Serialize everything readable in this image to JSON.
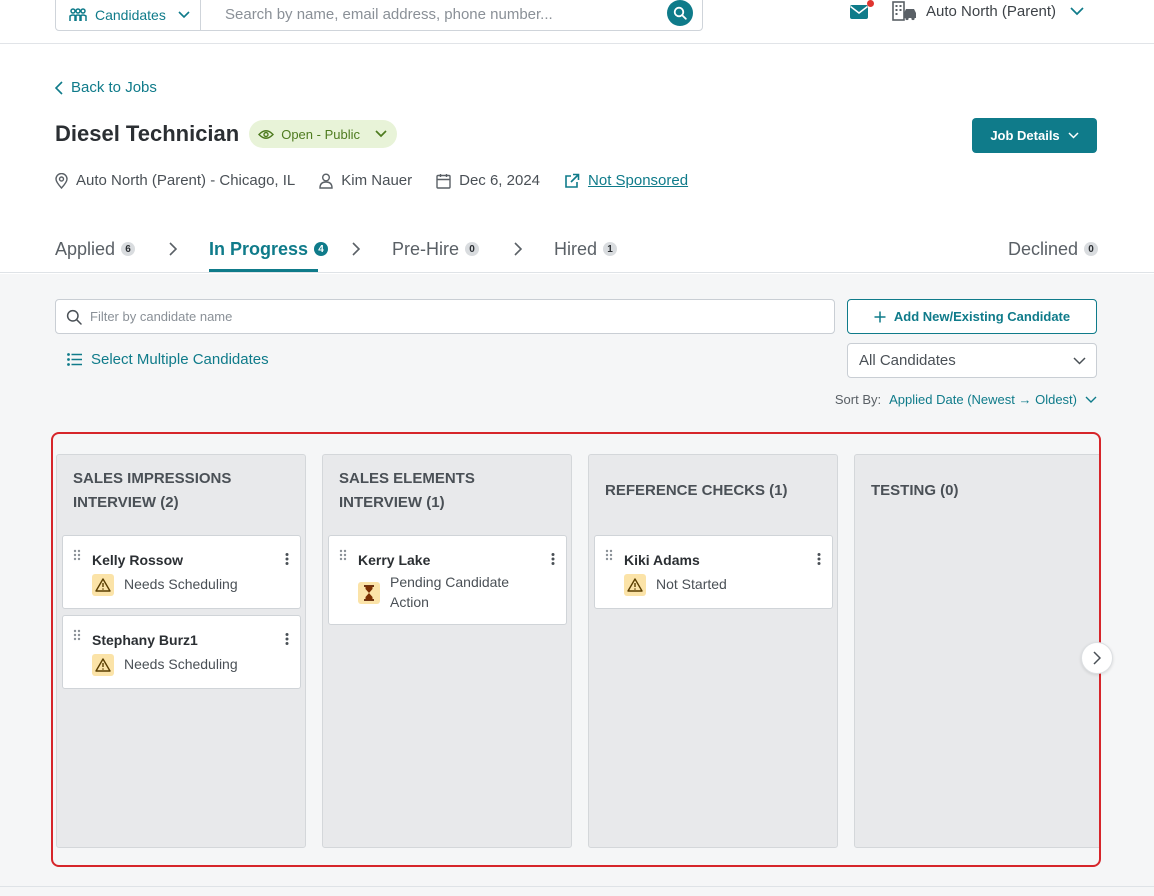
{
  "topbar": {
    "entity_select": "Candidates",
    "search_placeholder": "Search by name, email address, phone number...",
    "org_name": "Auto North (Parent)"
  },
  "header": {
    "back_label": "Back to Jobs",
    "job_title": "Diesel Technician",
    "status": "Open - Public",
    "job_details_label": "Job Details",
    "location": "Auto North (Parent) - Chicago, IL",
    "recruiter": "Kim Nauer",
    "date": "Dec 6, 2024",
    "sponsorship": "Not Sponsored"
  },
  "tabs": [
    {
      "label": "Applied",
      "count": "6"
    },
    {
      "label": "In Progress",
      "count": "4"
    },
    {
      "label": "Pre-Hire",
      "count": "0"
    },
    {
      "label": "Hired",
      "count": "1"
    },
    {
      "label": "Declined",
      "count": "0"
    }
  ],
  "toolbar": {
    "filter_placeholder": "Filter by candidate name",
    "add_candidate_label": "Add New/Existing Candidate",
    "select_multiple_label": "Select Multiple Candidates",
    "candidate_filter_value": "All Candidates",
    "sort_label": "Sort By:",
    "sort_value": "Applied Date (Newest → Oldest)"
  },
  "board": {
    "columns": [
      {
        "title": "SALES IMPRESSIONS INTERVIEW (2)",
        "cards": [
          {
            "name": "Kelly Rossow",
            "status": "Needs Scheduling",
            "status_icon": "warning-icon"
          },
          {
            "name": "Stephany Burz1",
            "status": "Needs Scheduling",
            "status_icon": "warning-icon"
          }
        ]
      },
      {
        "title": "SALES ELEMENTS INTERVIEW (1)",
        "cards": [
          {
            "name": "Kerry Lake",
            "status": "Pending Candidate Action",
            "status_icon": "hourglass-icon"
          }
        ]
      },
      {
        "title": "REFERENCE CHECKS (1)",
        "cards": [
          {
            "name": "Kiki Adams",
            "status": "Not Started",
            "status_icon": "warning-icon"
          }
        ]
      },
      {
        "title": "TESTING (0)",
        "cards": []
      }
    ]
  },
  "colors": {
    "accent": "#0f7b8a",
    "status_open_bg": "#e8f3d8",
    "status_open_text": "#4e7b1f",
    "highlight_border": "#d6252a",
    "notification_dot": "#e0342f",
    "warning_bg": "#fbe3a8"
  }
}
